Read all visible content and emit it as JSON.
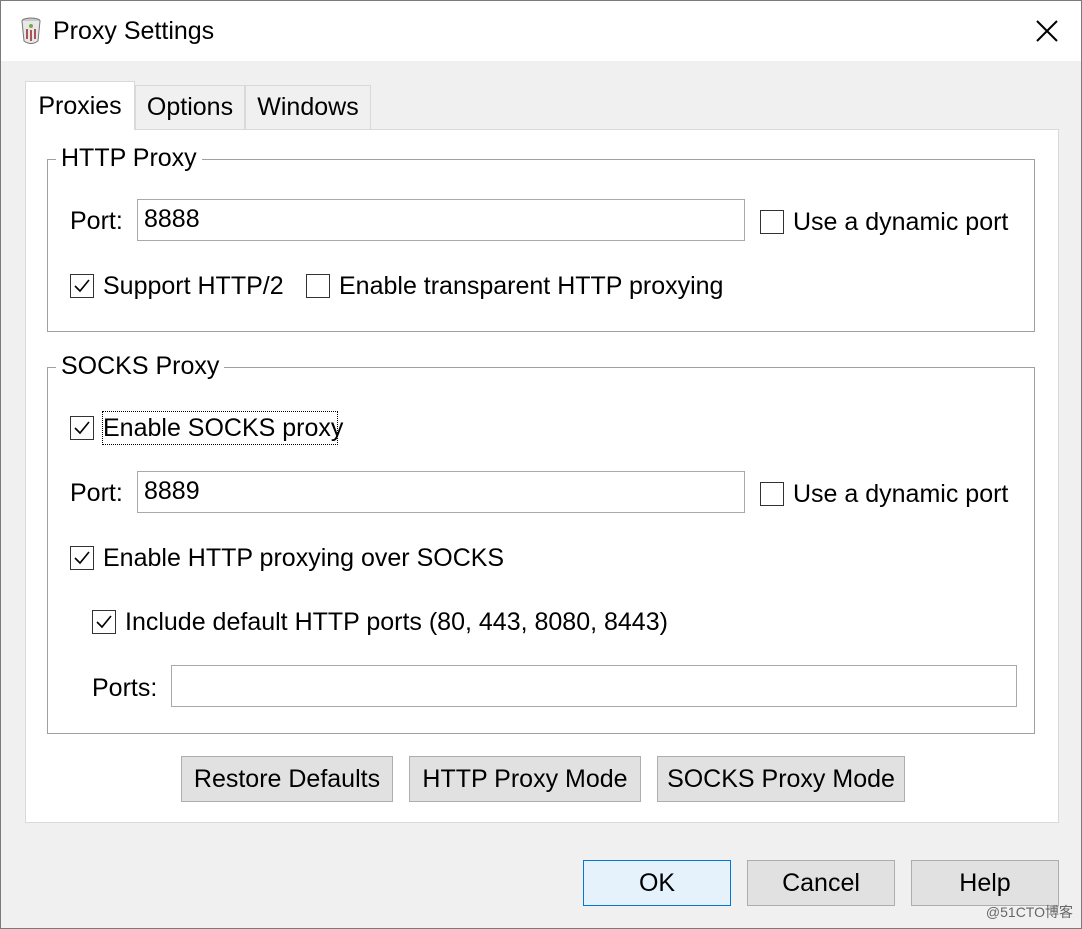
{
  "window": {
    "title": "Proxy Settings",
    "app_icon": "fiddler-icon",
    "close_icon": "close-icon"
  },
  "tabs": [
    {
      "label": "Proxies",
      "active": true
    },
    {
      "label": "Options",
      "active": false
    },
    {
      "label": "Windows",
      "active": false
    }
  ],
  "http_proxy": {
    "group_title": "HTTP Proxy",
    "port_label": "Port:",
    "port_value": "8888",
    "dynamic_port_label": "Use a dynamic port",
    "dynamic_port_checked": false,
    "http2_label": "Support HTTP/2",
    "http2_checked": true,
    "transparent_label": "Enable transparent HTTP proxying",
    "transparent_checked": false
  },
  "socks_proxy": {
    "group_title": "SOCKS Proxy",
    "enable_label": "Enable SOCKS proxy",
    "enable_checked": true,
    "port_label": "Port:",
    "port_value": "8889",
    "dynamic_port_label": "Use a dynamic port",
    "dynamic_port_checked": false,
    "http_over_socks_label": "Enable HTTP proxying over SOCKS",
    "http_over_socks_checked": true,
    "default_ports_label": "Include default HTTP ports (80, 443, 8080, 8443)",
    "default_ports_checked": true,
    "ports_label": "Ports:",
    "ports_value": ""
  },
  "panel_buttons": {
    "restore": "Restore Defaults",
    "http_mode": "HTTP Proxy Mode",
    "socks_mode": "SOCKS Proxy Mode"
  },
  "dialog_buttons": {
    "ok": "OK",
    "cancel": "Cancel",
    "help": "Help"
  },
  "watermark": "@51CTO博客",
  "colors": {
    "window_bg": "#f0f0f0",
    "panel_bg": "#ffffff",
    "default_button_border": "#0078d7",
    "default_button_bg": "#e5f1fb"
  }
}
